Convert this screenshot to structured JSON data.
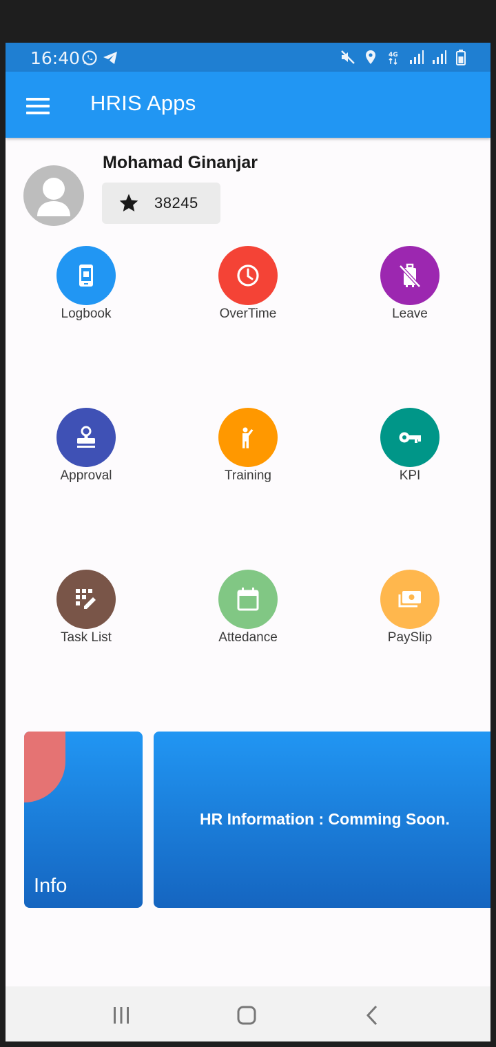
{
  "status_bar": {
    "time": "16:40",
    "left_icons": [
      "whatsapp-icon",
      "telegram-icon"
    ],
    "right_icons": [
      "mute-icon",
      "location-icon",
      "4g-data-icon",
      "signal-icon",
      "signal-icon",
      "battery-icon"
    ]
  },
  "app_bar": {
    "title": "HRIS Apps",
    "menu_icon": "hamburger-menu-icon"
  },
  "profile": {
    "name": "Mohamad Ginanjar",
    "points": "38245",
    "points_icon": "star-icon"
  },
  "menu": [
    {
      "label": "Logbook",
      "icon": "phone-book-icon",
      "color": "#2196f3"
    },
    {
      "label": "OverTime",
      "icon": "clock-icon",
      "color": "#f44336"
    },
    {
      "label": "Leave",
      "icon": "no-luggage-icon",
      "color": "#9c27b0"
    },
    {
      "label": "Approval",
      "icon": "stamp-icon",
      "color": "#3f51b5"
    },
    {
      "label": "Training",
      "icon": "person-raising-hand-icon",
      "color": "#ff9800"
    },
    {
      "label": "KPI",
      "icon": "key-icon",
      "color": "#009688"
    },
    {
      "label": "Task List",
      "icon": "grid-pencil-icon",
      "color": "#795548"
    },
    {
      "label": "Attedance",
      "icon": "calendar-icon",
      "color": "#81c784"
    },
    {
      "label": "PaySlip",
      "icon": "payments-icon",
      "color": "#ffb74d"
    }
  ],
  "cards": {
    "info_label": "Info",
    "hr_info": "HR Information : Comming Soon."
  },
  "nav_bar": {
    "buttons": [
      "recent-apps-icon",
      "home-icon",
      "back-icon"
    ]
  },
  "colors": {
    "app_bar": "#2196f3",
    "status_bar": "#1f7fd2",
    "card_gradient_top": "#2196f3",
    "card_gradient_bottom": "#1565c0",
    "info_accent": "#e57373"
  }
}
